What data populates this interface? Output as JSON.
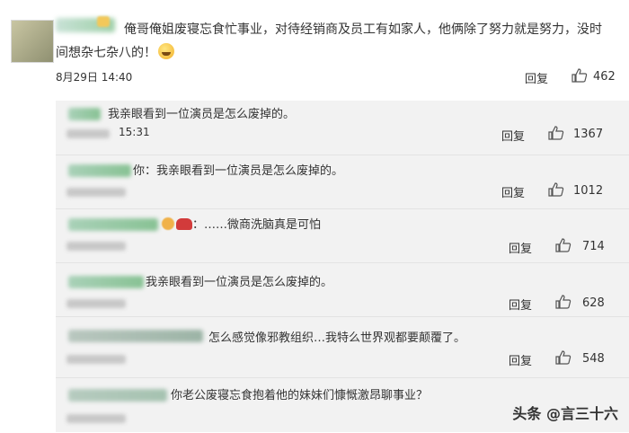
{
  "main_comment": {
    "text": "俺哥俺姐废寝忘食忙事业，对待经销商及员工有如家人，他俩除了努力就是努力，没时间想杂七杂八的！",
    "time": "8月29日 14:40",
    "reply_label": "回复",
    "likes": "462"
  },
  "replies": [
    {
      "text": "我亲眼看到一位演员是怎么废掉的。",
      "time": "15:31",
      "reply_label": "回复",
      "likes": "1367"
    },
    {
      "text": "你：我亲眼看到一位演员是怎么废掉的。",
      "time": "",
      "reply_label": "回复",
      "likes": "1012"
    },
    {
      "text": "：……微商洗脑真是可怕",
      "time": "",
      "reply_label": "回复",
      "likes": "714"
    },
    {
      "text": "我亲眼看到一位演员是怎么废掉的。",
      "time": "",
      "reply_label": "回复",
      "likes": "628"
    },
    {
      "text": "怎么感觉像邪教组织…我特么世界观都要颠覆了。",
      "time": "",
      "reply_label": "回复",
      "likes": "548"
    },
    {
      "text": "你老公废寝忘食抱着他的妹妹们慷慨激昂聊事业？",
      "time": "",
      "reply_label": "",
      "likes": ""
    }
  ],
  "watermark": "头条 @言三十六",
  "icons": {
    "like": "thumbs-up-icon",
    "emoji_laugh": "laughing-emoji-icon",
    "emoji_car": "car-emoji-icon"
  },
  "colors": {
    "sub_background": "#f2f2f2",
    "text": "#333333"
  }
}
